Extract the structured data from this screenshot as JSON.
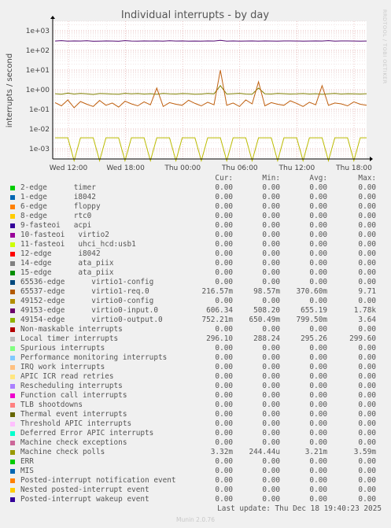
{
  "chart_data": {
    "type": "line",
    "title": "Individual interrupts - by day",
    "ylabel": "interrupts / second",
    "yscale": "log",
    "ylim": [
      0.0003,
      3000
    ],
    "y_ticks": [
      {
        "value": 1000,
        "label": "1e+03"
      },
      {
        "value": 100,
        "label": "1e+02"
      },
      {
        "value": 10,
        "label": "1e+01"
      },
      {
        "value": 1,
        "label": "1e+00"
      },
      {
        "value": 0.1,
        "label": "1e-01"
      },
      {
        "value": 0.01,
        "label": "1e-02"
      },
      {
        "value": 0.001,
        "label": "1e-03"
      }
    ],
    "x_ticks": [
      "Wed 12:00",
      "Wed 18:00",
      "Thu 00:00",
      "Thu 06:00",
      "Thu 12:00",
      "Thu 18:00"
    ],
    "grid": true,
    "series": [
      {
        "name": "Local timer interrupts",
        "color": "#550a73",
        "values": [
          296,
          310,
          292,
          300,
          298,
          305,
          289,
          295,
          300,
          296,
          290,
          312,
          298,
          294,
          300,
          296,
          299,
          291,
          305,
          296,
          300,
          295,
          298,
          293,
          300,
          296,
          320,
          292,
          299,
          295,
          297,
          300,
          294,
          301,
          296,
          292,
          299,
          300,
          296,
          294,
          298,
          300,
          296,
          310,
          293,
          299,
          300,
          296,
          295,
          297
        ]
      },
      {
        "name": "virtio0-input.0",
        "color": "#7f7f00",
        "values": [
          0.62,
          0.58,
          0.66,
          0.6,
          0.64,
          0.61,
          0.57,
          0.63,
          0.62,
          0.6,
          0.59,
          0.65,
          0.61,
          0.63,
          0.6,
          0.62,
          0.58,
          0.64,
          0.61,
          0.6,
          0.63,
          0.62,
          0.59,
          0.6,
          0.64,
          0.61,
          1.6,
          0.6,
          0.62,
          0.65,
          0.6,
          0.59,
          1.2,
          0.61,
          0.6,
          0.64,
          0.62,
          0.6,
          0.61,
          0.63,
          0.6,
          0.62,
          0.59,
          0.61,
          0.64,
          0.6,
          0.62,
          0.61,
          0.6,
          0.62
        ]
      },
      {
        "name": "virtio1-req.0",
        "color": "#c06010",
        "values": [
          0.22,
          0.15,
          0.3,
          0.12,
          0.25,
          0.18,
          0.14,
          0.28,
          0.16,
          0.21,
          0.13,
          0.26,
          0.19,
          0.15,
          0.24,
          0.17,
          1.2,
          0.14,
          0.22,
          0.18,
          0.16,
          0.29,
          0.2,
          0.15,
          0.23,
          0.17,
          9.71,
          0.16,
          0.21,
          0.14,
          0.3,
          0.19,
          2.5,
          0.15,
          0.22,
          0.18,
          0.16,
          0.27,
          0.2,
          0.14,
          0.23,
          0.17,
          1.6,
          0.16,
          0.21,
          0.19,
          0.15,
          0.24,
          0.18,
          0.16
        ]
      },
      {
        "name": "Machine check polls",
        "color": "#bbbb00",
        "values": [
          0.00359,
          0.00359,
          0.00359,
          0.000244,
          0.00359,
          0.00359,
          0.00359,
          0.000244,
          0.00359,
          0.00359,
          0.00359,
          0.000244,
          0.00359,
          0.00359,
          0.00359,
          0.000244,
          0.00359,
          0.00359,
          0.00359,
          0.000244,
          0.00359,
          0.00359,
          0.00359,
          0.000244,
          0.00359,
          0.00359,
          0.00359,
          0.000244,
          0.00359,
          0.00359,
          0.00359,
          0.000244,
          0.00359,
          0.00359,
          0.00359,
          0.000244,
          0.00359,
          0.00359,
          0.00359,
          0.000244,
          0.00359,
          0.00359,
          0.00359,
          0.000244,
          0.00359,
          0.00359,
          0.00359,
          0.000244,
          0.00359,
          0.00359
        ]
      }
    ]
  },
  "side_label": "RRDTOOL / TOBI OETIKER",
  "legend": {
    "headers": [
      "Cur:",
      "Min:",
      "Avg:",
      "Max:"
    ],
    "rows": [
      {
        "name": "2-edge      timer",
        "color": "#00cc00",
        "cur": "0.00",
        "min": "0.00",
        "avg": "0.00",
        "max": "0.00"
      },
      {
        "name": "1-edge      i8042",
        "color": "#0066b3",
        "cur": "0.00",
        "min": "0.00",
        "avg": "0.00",
        "max": "0.00"
      },
      {
        "name": "6-edge      floppy",
        "color": "#ff8000",
        "cur": "0.00",
        "min": "0.00",
        "avg": "0.00",
        "max": "0.00"
      },
      {
        "name": "8-edge      rtc0",
        "color": "#ffcc00",
        "cur": "0.00",
        "min": "0.00",
        "avg": "0.00",
        "max": "0.00"
      },
      {
        "name": "9-fasteoi   acpi",
        "color": "#330099",
        "cur": "0.00",
        "min": "0.00",
        "avg": "0.00",
        "max": "0.00"
      },
      {
        "name": "10-fasteoi   virtio2",
        "color": "#990099",
        "cur": "0.00",
        "min": "0.00",
        "avg": "0.00",
        "max": "0.00"
      },
      {
        "name": "11-fasteoi   uhci_hcd:usb1",
        "color": "#ccff00",
        "cur": "0.00",
        "min": "0.00",
        "avg": "0.00",
        "max": "0.00"
      },
      {
        "name": "12-edge      i8042",
        "color": "#ff0000",
        "cur": "0.00",
        "min": "0.00",
        "avg": "0.00",
        "max": "0.00"
      },
      {
        "name": "14-edge      ata_piix",
        "color": "#808080",
        "cur": "0.00",
        "min": "0.00",
        "avg": "0.00",
        "max": "0.00"
      },
      {
        "name": "15-edge      ata_piix",
        "color": "#008f00",
        "cur": "0.00",
        "min": "0.00",
        "avg": "0.00",
        "max": "0.00"
      },
      {
        "name": "65536-edge      virtio1-config",
        "color": "#00487d",
        "cur": "0.00",
        "min": "0.00",
        "avg": "0.00",
        "max": "0.00"
      },
      {
        "name": "65537-edge      virtio1-req.0",
        "color": "#b35a00",
        "cur": "216.57m",
        "min": "98.57m",
        "avg": "370.60m",
        "max": "9.71"
      },
      {
        "name": "49152-edge      virtio0-config",
        "color": "#b38f00",
        "cur": "0.00",
        "min": "0.00",
        "avg": "0.00",
        "max": "0.00"
      },
      {
        "name": "49153-edge      virtio0-input.0",
        "color": "#6b006b",
        "cur": "606.34",
        "min": "508.20",
        "avg": "655.19",
        "max": "1.78k"
      },
      {
        "name": "49154-edge      virtio0-output.0",
        "color": "#8fb300",
        "cur": "752.21m",
        "min": "650.49m",
        "avg": "799.50m",
        "max": "3.64"
      },
      {
        "name": "Non-maskable interrupts",
        "color": "#b30000",
        "cur": "0.00",
        "min": "0.00",
        "avg": "0.00",
        "max": "0.00"
      },
      {
        "name": "Local timer interrupts",
        "color": "#bebebe",
        "cur": "296.10",
        "min": "288.24",
        "avg": "295.26",
        "max": "299.60"
      },
      {
        "name": "Spurious interrupts",
        "color": "#80ff80",
        "cur": "0.00",
        "min": "0.00",
        "avg": "0.00",
        "max": "0.00"
      },
      {
        "name": "Performance monitoring interrupts",
        "color": "#80c9ff",
        "cur": "0.00",
        "min": "0.00",
        "avg": "0.00",
        "max": "0.00"
      },
      {
        "name": "IRQ work interrupts",
        "color": "#ffc080",
        "cur": "0.00",
        "min": "0.00",
        "avg": "0.00",
        "max": "0.00"
      },
      {
        "name": "APIC ICR read retries",
        "color": "#ffe680",
        "cur": "0.00",
        "min": "0.00",
        "avg": "0.00",
        "max": "0.00"
      },
      {
        "name": "Rescheduling interrupts",
        "color": "#aa80ff",
        "cur": "0.00",
        "min": "0.00",
        "avg": "0.00",
        "max": "0.00"
      },
      {
        "name": "Function call interrupts",
        "color": "#ee00cc",
        "cur": "0.00",
        "min": "0.00",
        "avg": "0.00",
        "max": "0.00"
      },
      {
        "name": "TLB shootdowns",
        "color": "#ff8080",
        "cur": "0.00",
        "min": "0.00",
        "avg": "0.00",
        "max": "0.00"
      },
      {
        "name": "Thermal event interrupts",
        "color": "#666600",
        "cur": "0.00",
        "min": "0.00",
        "avg": "0.00",
        "max": "0.00"
      },
      {
        "name": "Threshold APIC interrupts",
        "color": "#ffbfff",
        "cur": "0.00",
        "min": "0.00",
        "avg": "0.00",
        "max": "0.00"
      },
      {
        "name": "Deferred Error APIC interrupts",
        "color": "#00ffcc",
        "cur": "0.00",
        "min": "0.00",
        "avg": "0.00",
        "max": "0.00"
      },
      {
        "name": "Machine check exceptions",
        "color": "#cc6699",
        "cur": "0.00",
        "min": "0.00",
        "avg": "0.00",
        "max": "0.00"
      },
      {
        "name": "Machine check polls",
        "color": "#999900",
        "cur": "3.32m",
        "min": "244.44u",
        "avg": "3.21m",
        "max": "3.59m"
      },
      {
        "name": "ERR",
        "color": "#00cc00",
        "cur": "0.00",
        "min": "0.00",
        "avg": "0.00",
        "max": "0.00"
      },
      {
        "name": "MIS",
        "color": "#0066b3",
        "cur": "0.00",
        "min": "0.00",
        "avg": "0.00",
        "max": "0.00"
      },
      {
        "name": "Posted-interrupt notification event",
        "color": "#ff8000",
        "cur": "0.00",
        "min": "0.00",
        "avg": "0.00",
        "max": "0.00"
      },
      {
        "name": "Nested posted-interrupt event",
        "color": "#ffcc00",
        "cur": "0.00",
        "min": "0.00",
        "avg": "0.00",
        "max": "0.00"
      },
      {
        "name": "Posted-interrupt wakeup event",
        "color": "#330099",
        "cur": "0.00",
        "min": "0.00",
        "avg": "0.00",
        "max": "0.00"
      }
    ]
  },
  "footer": "Last update: Thu Dec 18 19:40:23 2025",
  "munin_version": "Munin 2.0.76"
}
